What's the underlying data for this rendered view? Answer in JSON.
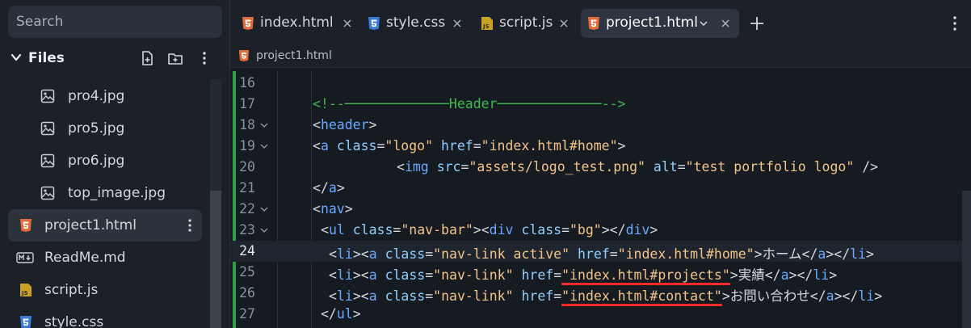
{
  "sidebar": {
    "search_placeholder": "Search",
    "files_title": "Files",
    "items": [
      {
        "name": "pro4.jpg",
        "icon": "image-file-icon"
      },
      {
        "name": "pro5.jpg",
        "icon": "image-file-icon"
      },
      {
        "name": "pro6.jpg",
        "icon": "image-file-icon"
      },
      {
        "name": "top_image.jpg",
        "icon": "image-file-icon"
      },
      {
        "name": "project1.html",
        "icon": "html5-file-icon"
      },
      {
        "name": "ReadMe.md",
        "icon": "markdown-file-icon"
      },
      {
        "name": "script.js",
        "icon": "js-file-icon"
      },
      {
        "name": "style.css",
        "icon": "css3-file-icon"
      }
    ]
  },
  "tabs": [
    {
      "label": "index.html",
      "icon": "html5-file-icon"
    },
    {
      "label": "style.css",
      "icon": "css3-file-icon"
    },
    {
      "label": "script.js",
      "icon": "js-file-icon"
    },
    {
      "label": "project1.html",
      "icon": "html5-file-icon"
    }
  ],
  "breadcrumb": "project1.html",
  "code": {
    "line_numbers": [
      "16",
      "17",
      "18",
      "19",
      "20",
      "21",
      "22",
      "23",
      "24",
      "25",
      "26",
      "27"
    ],
    "l17": {
      "open": "<!--",
      "dash1": "─────────────",
      "word": "Header",
      "dash2": "─────────────",
      "close": "-->"
    },
    "l18": {
      "lt": "<",
      "tag": "header",
      "gt": ">"
    },
    "l19": {
      "lt": "<",
      "tag": "a",
      "a1": "class",
      "eq1": "=",
      "v1": "\"logo\"",
      "a2": "href",
      "eq2": "=",
      "v2": "\"index.html#home\"",
      "gt": ">"
    },
    "l20": {
      "lt": "<",
      "tag": "img",
      "a1": "src",
      "eq1": "=",
      "v1": "\"assets/logo_test.png\"",
      "a2": "alt",
      "eq2": "=",
      "v2": "\"test portfolio logo\"",
      "end": "/>"
    },
    "l21": {
      "lt": "</",
      "tag": "a",
      "gt": ">"
    },
    "l22": {
      "lt": "<",
      "tag": "nav",
      "gt": ">"
    },
    "l23": {
      "lt1": "<",
      "tag1": "ul",
      "a1": "class",
      "eq1": "=",
      "v1": "\"nav-bar\"",
      "gt1": "><",
      "tag2": "div",
      "a2": "class",
      "eq2": "=",
      "v2": "\"bg\"",
      "gt2": "></",
      "tag3": "div",
      "gt3": ">"
    },
    "l24": {
      "lt1": "<",
      "tag1": "li",
      "m1": "><",
      "tag2": "a",
      "a1": "class",
      "eq1": "=",
      "v1": "\"nav-link active\"",
      "a2": "href",
      "eq2": "=",
      "v2": "\"index.html#home\"",
      "gt": ">",
      "text": "ホーム",
      "c1": "</",
      "ctag1": "a",
      "c2": "></",
      "ctag2": "li",
      "c3": ">"
    },
    "l25": {
      "lt1": "<",
      "tag1": "li",
      "m1": "><",
      "tag2": "a",
      "a1": "class",
      "eq1": "=",
      "v1": "\"nav-link\"",
      "a2": "href",
      "eq2": "=",
      "q1": "\"",
      "v2": "index.html#projects",
      "q2": "\"",
      "gt": ">",
      "text": "実績",
      "c1": "</",
      "ctag1": "a",
      "c2": "></",
      "ctag2": "li",
      "c3": ">"
    },
    "l26": {
      "lt1": "<",
      "tag1": "li",
      "m1": "><",
      "tag2": "a",
      "a1": "class",
      "eq1": "=",
      "v1": "\"nav-link\"",
      "a2": "href",
      "eq2": "=",
      "q1": "\"",
      "v2": "index.html#contact",
      "q2": "\"",
      "gt": ">",
      "text": "お問い合わせ",
      "c1": "</",
      "ctag1": "a",
      "c2": "></",
      "ctag2": "li",
      "c3": ">"
    },
    "l27": {
      "lt": "</",
      "tag": "ul",
      "gt": ">"
    }
  },
  "colors": {
    "tag": "#6aa9ff",
    "attribute": "#8fd0ff",
    "string": "#f3c48a",
    "comment": "#3fb950",
    "html_icon": "#e06c3a",
    "css_icon": "#3a7bd5",
    "js_icon": "#c9a227",
    "annotation": "#ff2a2a"
  }
}
